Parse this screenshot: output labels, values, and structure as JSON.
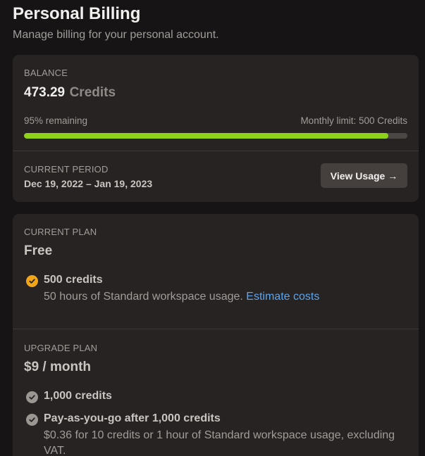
{
  "header": {
    "title": "Personal Billing",
    "subtitle": "Manage billing for your personal account."
  },
  "balance": {
    "label": "BALANCE",
    "value": "473.29",
    "unit": "Credits",
    "remaining_text": "95% remaining",
    "limit_text": "Monthly limit: 500 Credits",
    "remaining_fraction": 0.95,
    "progress_color": "#8fd21c"
  },
  "period": {
    "label": "CURRENT PERIOD",
    "dates": "Dec 19, 2022 – Jan 19, 2023",
    "button_label": "View Usage →"
  },
  "current_plan": {
    "label": "CURRENT PLAN",
    "name": "Free",
    "feature_title": "500 credits",
    "feature_desc": "50 hours of Standard workspace usage.",
    "feature_link": "Estimate costs",
    "check_icon": "check-circle-icon",
    "check_color": "#f2a516"
  },
  "upgrade_plan": {
    "label": "UPGRADE PLAN",
    "price": "$9 / month",
    "features": [
      {
        "title": "1,000 credits",
        "desc": ""
      },
      {
        "title": "Pay-as-you-go after 1,000 credits",
        "desc": "$0.36 for 10 credits or 1 hour of Standard workspace usage, excluding VAT."
      }
    ],
    "check_icon": "check-circle-icon",
    "check_color": "#9a9692"
  },
  "colors": {
    "background": "#161414",
    "card": "#272322",
    "accent_link": "#5aa5f2"
  }
}
